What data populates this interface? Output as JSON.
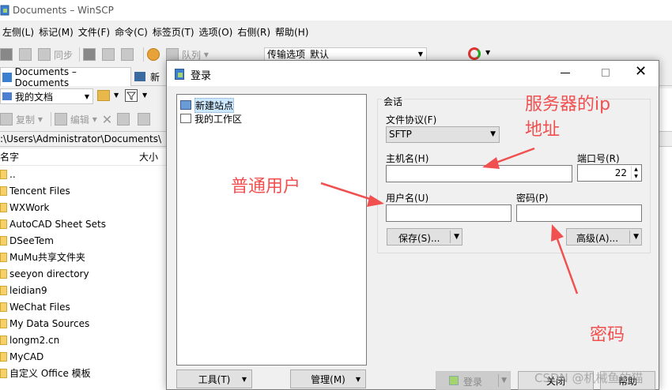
{
  "window": {
    "title": "Documents – WinSCP"
  },
  "menubar": {
    "items": [
      "左侧(L)",
      "标记(M)",
      "文件(F)",
      "命令(C)",
      "标签页(T)",
      "选项(O)",
      "右侧(R)",
      "帮助(H)"
    ]
  },
  "toolbar": {
    "sync_label": "同步",
    "queue_label": "队列",
    "transfer_options_label": "传输选项",
    "transfer_options_value": "默认"
  },
  "tabs": {
    "documents": "Documents – Documents",
    "new": "新"
  },
  "local_panel": {
    "path_combo": "我的文档",
    "copy_label": "复制",
    "edit_label": "编辑",
    "path": ":\\Users\\Administrator\\Documents\\",
    "columns": {
      "name": "名字",
      "size": "大小"
    },
    "files": [
      "..",
      "Tencent Files",
      "WXWork",
      "AutoCAD Sheet Sets",
      "DSeeTem",
      "MuMu共享文件夹",
      "seeyon directory",
      "leidian9",
      "WeChat Files",
      "My Data Sources",
      "longm2.cn",
      "MyCAD",
      "自定义 Office 模板"
    ]
  },
  "dialog": {
    "title": "登录",
    "sites": {
      "new_site": "新建站点",
      "workspace": "我的工作区"
    },
    "tools_button": "工具(T)",
    "manage_button": "管理(M)",
    "session": {
      "legend": "会话",
      "protocol_label": "文件协议(F)",
      "protocol_value": "SFTP",
      "host_label": "主机名(H)",
      "host_value": "",
      "port_label": "端口号(R)",
      "port_value": "22",
      "user_label": "用户名(U)",
      "user_value": "",
      "password_label": "密码(P)",
      "password_value": "",
      "save_button": "保存(S)...",
      "advanced_button": "高级(A)..."
    },
    "login_button": "登录",
    "close_button": "关闭",
    "help_button": "帮助"
  },
  "annotations": {
    "server_ip_line1": "服务器的ip",
    "server_ip_line2": "地址",
    "normal_user": "普通用户",
    "password": "密码",
    "color": "#f05050"
  },
  "watermark": "CSDN @机械鱼的猫"
}
